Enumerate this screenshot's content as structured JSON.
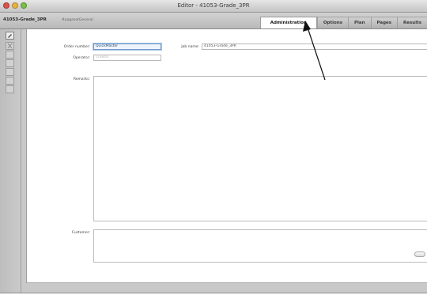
{
  "window": {
    "title": "Editor - 41053-Grade_3PR"
  },
  "header": {
    "doc_name": "41053-Grade_3PR",
    "doc_sub": "#pagesetGeneral"
  },
  "tabs": [
    {
      "label": "Administration",
      "active": true
    },
    {
      "label": "Options",
      "active": false
    },
    {
      "label": "Plan",
      "active": false
    },
    {
      "label": "Pages",
      "active": false
    },
    {
      "label": "Results",
      "active": false
    }
  ],
  "form": {
    "order_number_label": "Order number:",
    "order_number_value": "QuickMaster",
    "job_name_label": "Job name:",
    "job_name_value": "41053-Grade_3PR",
    "operator_label": "Operator:",
    "operator_placeholder": "Creator",
    "remarks_label": "Remarks:",
    "customer_label": "Customer:"
  },
  "sidebar": {
    "icons": [
      "edit-icon",
      "close-icon",
      "tool-icon",
      "tool-icon",
      "tool-icon",
      "tool-icon",
      "tool-icon"
    ]
  },
  "colors": {
    "focus_blue": "#6f99c9",
    "window_gray": "#c9c9c9"
  }
}
